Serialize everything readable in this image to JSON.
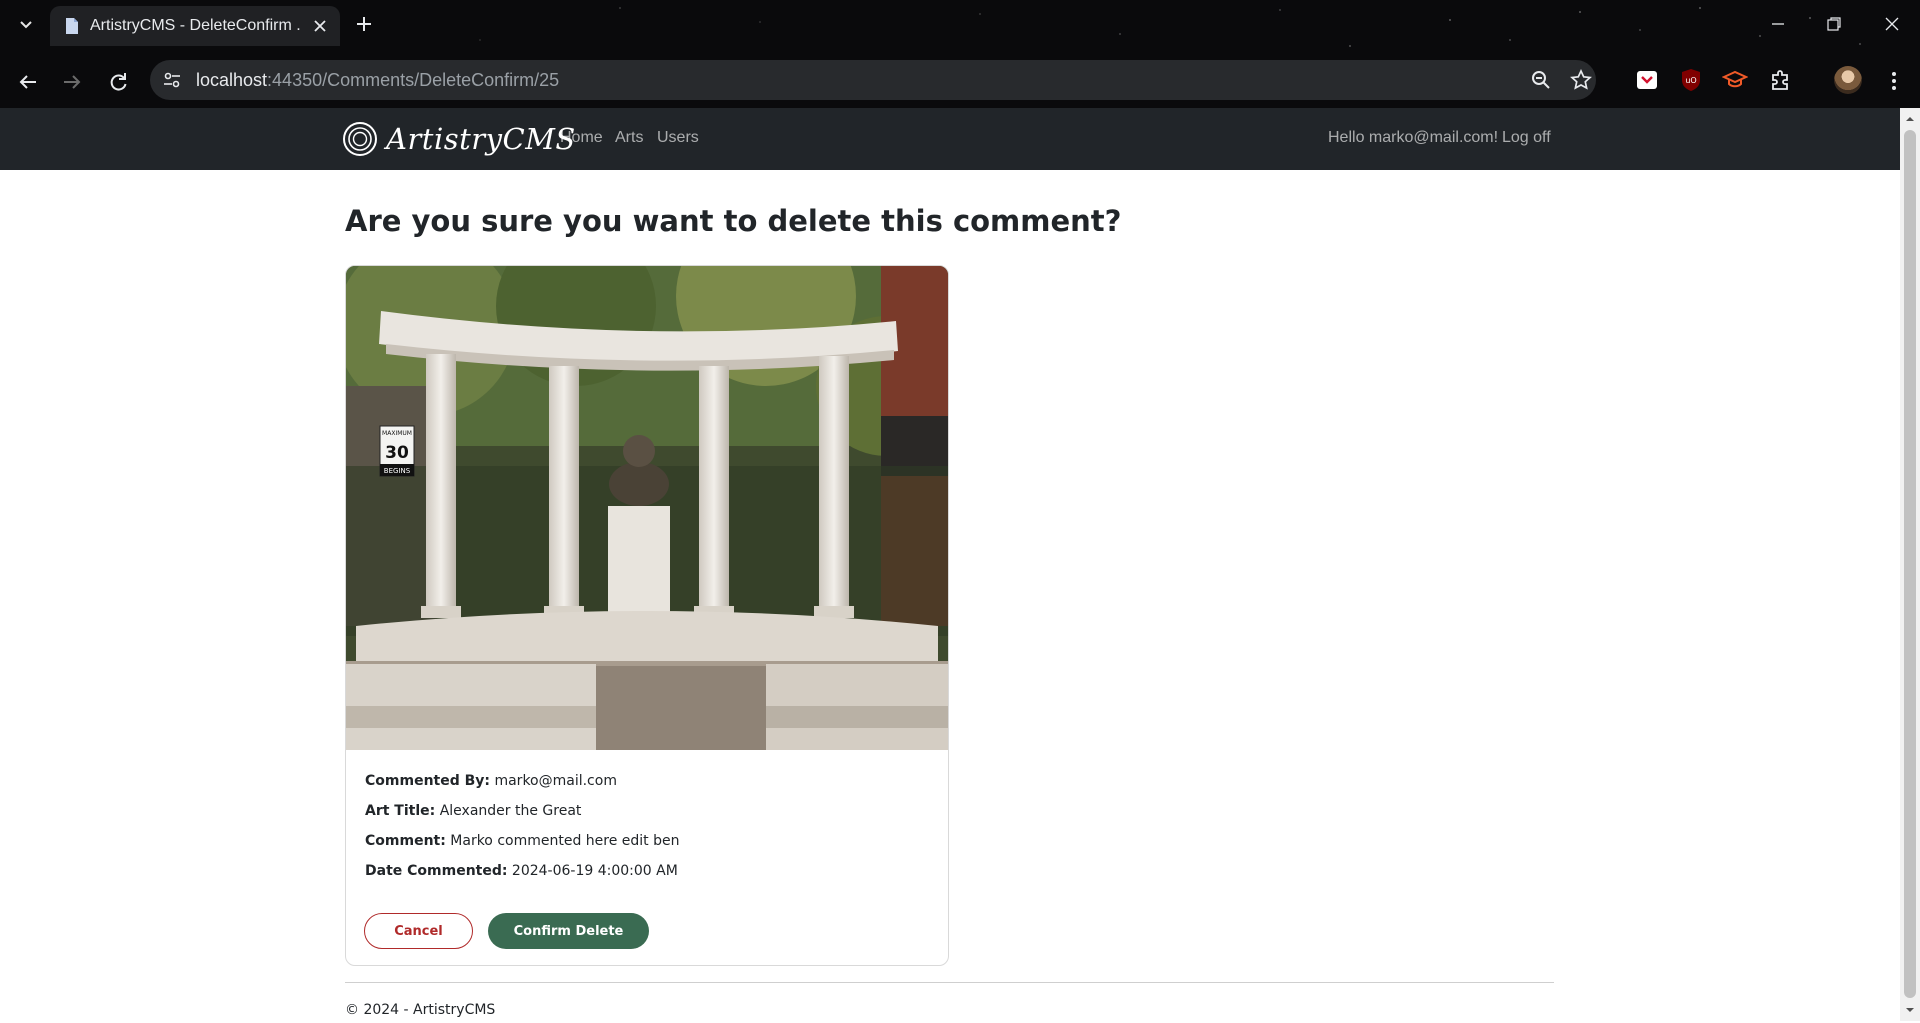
{
  "browser": {
    "tab_title": "ArtistryCMS - DeleteConfirm .",
    "url_host": "localhost",
    "url_rest": ":44350/Comments/DeleteConfirm/25"
  },
  "site": {
    "brand": "ArtistryCMS",
    "nav": {
      "home": "Home",
      "arts": "Arts",
      "users": "Users"
    },
    "greeting": "Hello marko@mail.com!",
    "logoff": "Log off"
  },
  "page": {
    "heading": "Are you sure you want to delete this comment?",
    "details": {
      "commented_by_label": "Commented By:",
      "commented_by": "marko@mail.com",
      "art_title_label": "Art Title:",
      "art_title": "Alexander the Great",
      "comment_label": "Comment:",
      "comment": "Marko commented here edit ben",
      "date_label": "Date Commented:",
      "date": "2024-06-19 4:00:00 AM"
    },
    "buttons": {
      "cancel": "Cancel",
      "confirm": "Confirm Delete"
    },
    "sign_text": {
      "top": "MAXIMUM",
      "speed": "30",
      "bottom": "BEGINS"
    },
    "footer": "© 2024 - ArtistryCMS"
  },
  "colors": {
    "navbar": "#212529",
    "confirm_button": "#3a6b52",
    "cancel_border": "#b02a2a"
  }
}
